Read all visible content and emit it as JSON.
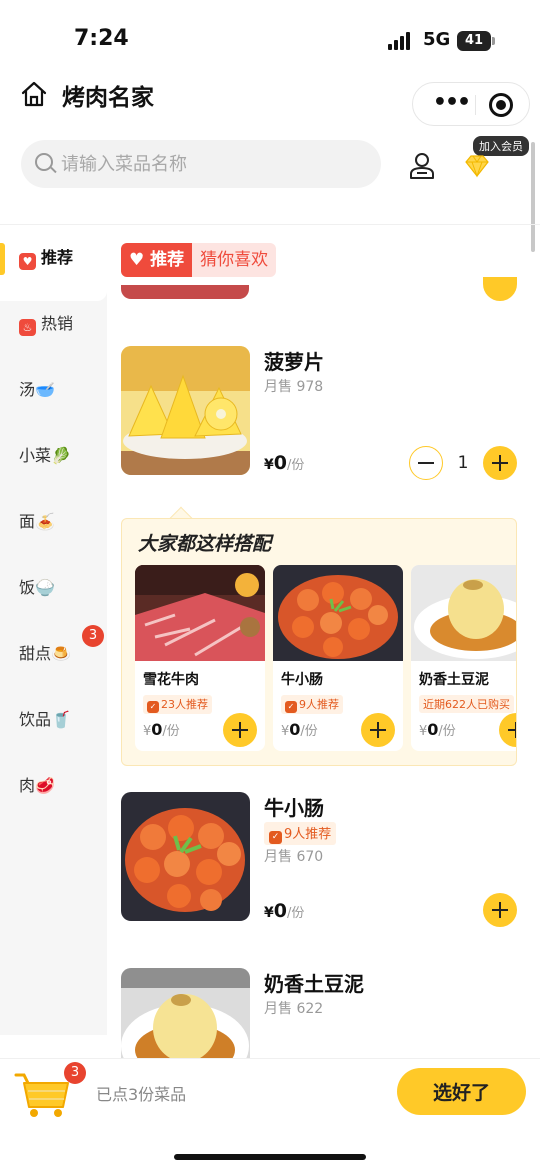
{
  "status_bar": {
    "time": "7:24",
    "network": "5G",
    "battery": "41"
  },
  "header": {
    "title": "烤肉名家",
    "more_icon": "more-dots-icon",
    "target_icon": "record-target-icon"
  },
  "search": {
    "placeholder": "请输入菜品名称",
    "value": ""
  },
  "member": {
    "badge": "加入会员"
  },
  "sidebar": {
    "items": [
      {
        "label": "推荐",
        "icon": "heart-tag-icon",
        "glyph": "♥",
        "active": true
      },
      {
        "label": "热销",
        "icon": "fire-tag-icon",
        "glyph": "♨"
      },
      {
        "label": "汤",
        "emoji": "🥣"
      },
      {
        "label": "小菜",
        "emoji": "🥬"
      },
      {
        "label": "面",
        "emoji": "🍝"
      },
      {
        "label": "饭",
        "emoji": "🍚"
      },
      {
        "label": "甜点",
        "emoji": "🍮",
        "badge": "3"
      },
      {
        "label": "饮品",
        "emoji": "🥤"
      },
      {
        "label": "肉",
        "emoji": "🥩"
      }
    ]
  },
  "section": {
    "tag": "推荐",
    "subtitle": "猜你喜欢"
  },
  "dishes": [
    {
      "name": "菠萝片",
      "sales": "月售 978",
      "currency": "¥",
      "price": "0",
      "unit": "/份",
      "quantity": "1"
    },
    {
      "name": "牛小肠",
      "recommend": "9人推荐",
      "sales": "月售 670",
      "currency": "¥",
      "price": "0",
      "unit": "/份"
    },
    {
      "name": "奶香土豆泥",
      "sales": "月售 622"
    }
  ],
  "combo": {
    "title": "大家都这样搭配",
    "items": [
      {
        "name": "雪花牛肉",
        "chip": "23人推荐",
        "currency": "¥",
        "price": "0",
        "unit": "/份"
      },
      {
        "name": "牛小肠",
        "chip": "9人推荐",
        "currency": "¥",
        "price": "0",
        "unit": "/份"
      },
      {
        "name": "奶香土豆泥",
        "chip": "近期622人已购买",
        "currency": "¥",
        "price": "0",
        "unit": "/份"
      }
    ]
  },
  "cart": {
    "badge": "3",
    "summary": "已点3份菜品",
    "checkout": "选好了"
  },
  "colors": {
    "accent": "#ffc928",
    "red": "#ef4b3c",
    "chip_orange": "#e35a1f"
  }
}
